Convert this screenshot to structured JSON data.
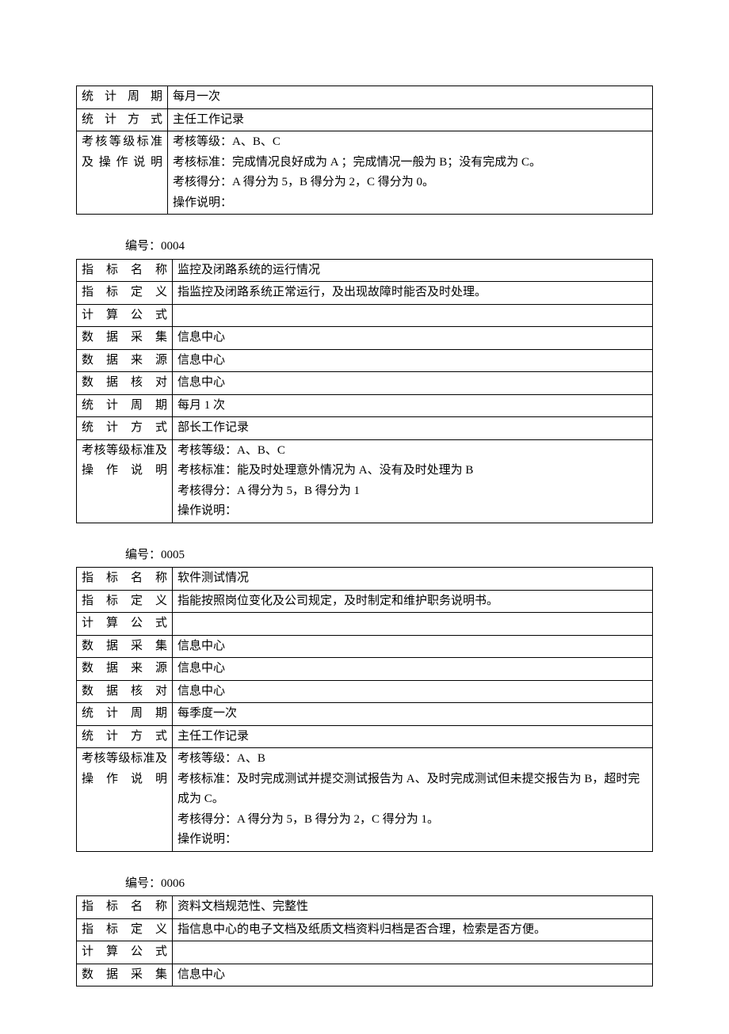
{
  "t1": {
    "rows": {
      "stat_period_label": "统计周期",
      "stat_period_value": "每月一次",
      "stat_method_label": "统计方式",
      "stat_method_value": "主任工作记录",
      "grade_label": "考核等级标准及操作说明",
      "grade_line1": "考核等级：A、B、C",
      "grade_line2": "考核标准：完成情况良好成为 A ；完成情况一般为 B；没有完成为 C。",
      "grade_line3": "考核得分：A 得分为 5，B 得分为 2，C 得分为 0。",
      "grade_line4": "操作说明："
    }
  },
  "t2": {
    "code": "编号：0004",
    "rows": {
      "name_label": "指标名称",
      "name_value": "监控及闭路系统的运行情况",
      "def_label": "指标定义",
      "def_value": "指监控及闭路系统正常运行，及出现故障时能否及时处理。",
      "formula_label": "计算公式",
      "formula_value": "",
      "collect_label": "数据采集",
      "collect_value": "信息中心",
      "source_label": "数据来源",
      "source_value": "信息中心",
      "verify_label": "数据核对",
      "verify_value": "信息中心",
      "stat_period_label": "统计周期",
      "stat_period_value": "每月 1 次",
      "stat_method_label": "统计方式",
      "stat_method_value": "部长工作记录",
      "grade_label": "考核等级标准及操作说明",
      "grade_line1": "考核等级：A、B、C",
      "grade_line2": "考核标准：能及时处理意外情况为 A、没有及时处理为 B",
      "grade_line3": "考核得分：A 得分为 5，B 得分为 1",
      "grade_line4": "操作说明："
    }
  },
  "t3": {
    "code": "编号：0005",
    "rows": {
      "name_label": "指标名称",
      "name_value": "软件测试情况",
      "def_label": "指标定义",
      "def_value": "指能按照岗位变化及公司规定，及时制定和维护职务说明书。",
      "formula_label": "计算公式",
      "formula_value": "",
      "collect_label": "数据采集",
      "collect_value": "信息中心",
      "source_label": "数据来源",
      "source_value": "信息中心",
      "verify_label": "数据核对",
      "verify_value": "信息中心",
      "stat_period_label": "统计周期",
      "stat_period_value": "每季度一次",
      "stat_method_label": "统计方式",
      "stat_method_value": "主任工作记录",
      "grade_label": "考核等级标准及操作说明",
      "grade_line1": "考核等级：A、B",
      "grade_line2": "考核标准：及时完成测试并提交测试报告为 A、及时完成测试但未提交报告为 B，超时完成为 C。",
      "grade_line3": "考核得分：A 得分为 5，B 得分为 2，C 得分为 1。",
      "grade_line4": "操作说明："
    }
  },
  "t4": {
    "code": "编号：0006",
    "rows": {
      "name_label": "指标名称",
      "name_value": "资料文档规范性、完整性",
      "def_label": "指标定义",
      "def_value": "指信息中心的电子文档及纸质文档资料归档是否合理，检索是否方便。",
      "formula_label": "计算公式",
      "formula_value": "",
      "collect_label": "数据采集",
      "collect_value": "信息中心"
    }
  }
}
